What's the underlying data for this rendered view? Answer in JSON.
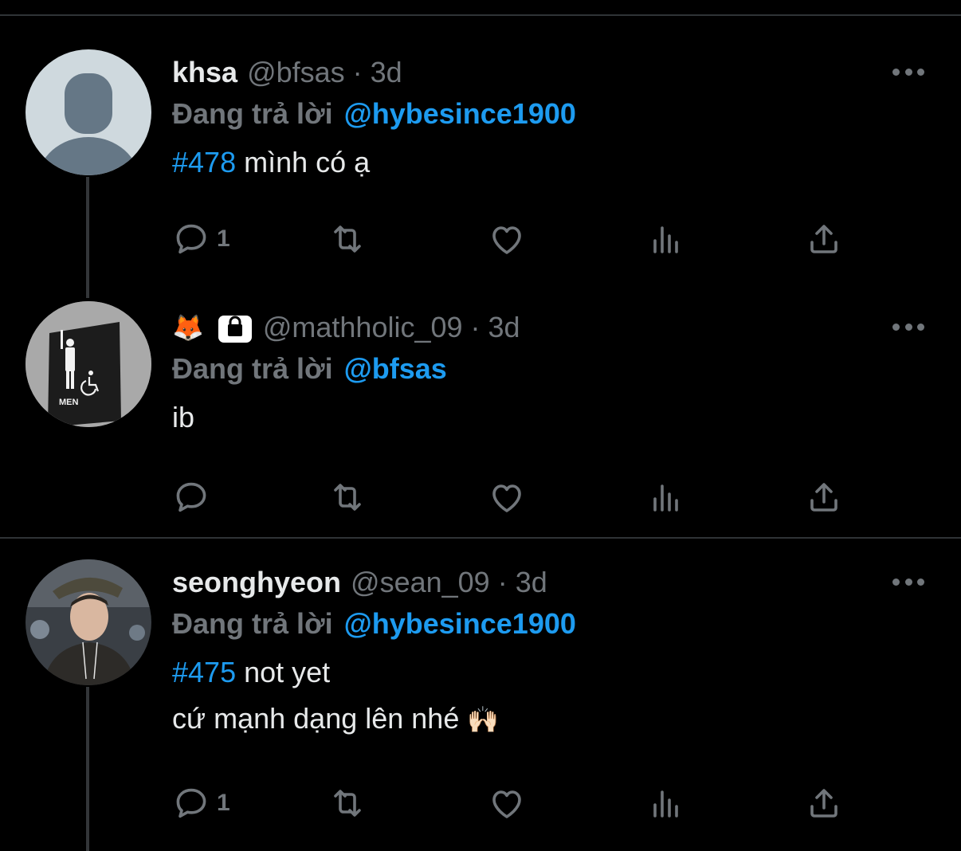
{
  "colors": {
    "background": "#000000",
    "text": "#e7e9ea",
    "muted": "#71767b",
    "link": "#1d9bf0",
    "divider": "#2f3336"
  },
  "tweets": [
    {
      "name": "khsa",
      "handle": "@bfsas",
      "dot": "·",
      "time": "3d",
      "reply_prefix": "Đang trả lời",
      "reply_to": "@hybesince1900",
      "hashtag": "#478",
      "text": " mình có ạ",
      "reply_count": "1",
      "avatar": "default-avatar-icon"
    },
    {
      "name_emoji": "🦊",
      "handle": "@mathholic_09",
      "dot": "·",
      "time": "3d",
      "reply_prefix": "Đang trả lời",
      "reply_to": "@bfsas",
      "text": "ib",
      "reply_count": "",
      "avatar": "men-restroom-sign-photo",
      "avatar_text": "MEN",
      "protected_icon": "lock-icon"
    },
    {
      "name": "seonghyeon",
      "handle": "@sean_09",
      "dot": "·",
      "time": "3d",
      "reply_prefix": "Đang trả lời",
      "reply_to": "@hybesince1900",
      "hashtag": "#475",
      "text": " not yet",
      "text_line2": "cứ mạnh dạng lên nhé ",
      "emoji": "🙌🏻",
      "reply_count": "1",
      "avatar": "person-selfie-photo"
    }
  ],
  "action_icons": [
    "reply-icon",
    "retweet-icon",
    "like-icon",
    "views-icon",
    "share-icon"
  ]
}
